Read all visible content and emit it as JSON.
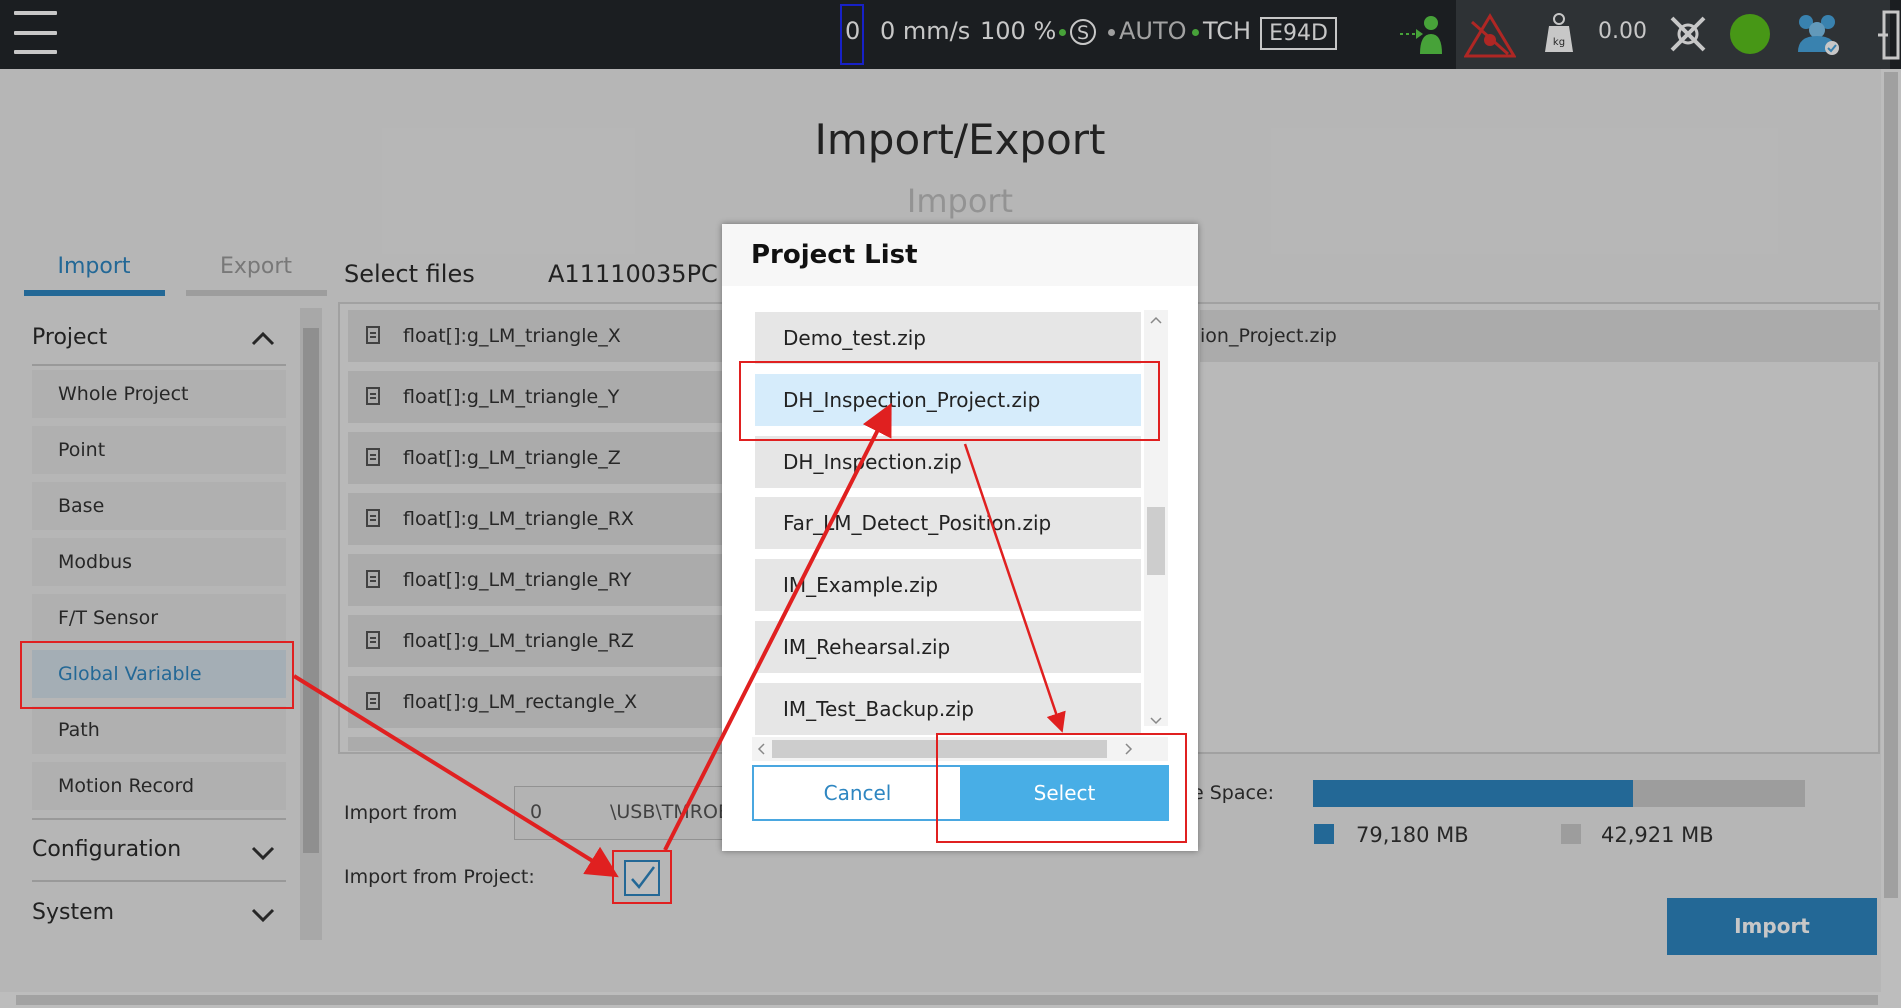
{
  "topbar": {
    "speed_value": "0",
    "speed_unit": "0 mm/s",
    "percent": "100 %",
    "s_label": "S",
    "auto_label": "AUTO",
    "tch_label": "TCH",
    "project_code": "E94D",
    "payload": "0.00",
    "kg_label": "kg"
  },
  "page": {
    "title": "Import/Export",
    "subtitle": "Import",
    "tabs": {
      "import": "Import",
      "export": "Export"
    }
  },
  "sidebar": {
    "project_header": "Project",
    "items": [
      "Whole Project",
      "Point",
      "Base",
      "Modbus",
      "F/T Sensor",
      "Global Variable",
      "Path",
      "Motion Record"
    ],
    "configuration_header": "Configuration",
    "system_header": "System"
  },
  "files": {
    "label": "Select files",
    "device_id": "A11110035PC",
    "items": [
      "float[]:g_LM_triangle_X",
      "float[]:g_LM_triangle_Y",
      "float[]:g_LM_triangle_Z",
      "float[]:g_LM_triangle_RX",
      "float[]:g_LM_triangle_RY",
      "float[]:g_LM_triangle_RZ",
      "float[]:g_LM_rectangle_X"
    ],
    "right_partial": "ion_Project.zip"
  },
  "import_from": {
    "label": "Import from",
    "value_index": "0",
    "value_path": "\\USB\\TMROB",
    "project_label": "Import from Project:",
    "project_checked": true
  },
  "storage": {
    "label": "e Space:",
    "used": "79,180 MB",
    "free": "42,921 MB",
    "used_fraction": 0.65
  },
  "import_button": "Import",
  "dialog": {
    "title": "Project List",
    "items": [
      "Demo_test.zip",
      "DH_Inspection_Project.zip",
      "DH_Inspection.zip",
      "Far_LM_Detect_Position.zip",
      "IM_Example.zip",
      "IM_Rehearsal.zip",
      "IM_Test_Backup.zip"
    ],
    "selected_index": 1,
    "cancel": "Cancel",
    "select": "Select"
  },
  "colors": {
    "accent": "#2e86c1",
    "select_button": "#48aee6",
    "annotation": "#e02020",
    "topbar": "#23272b"
  }
}
